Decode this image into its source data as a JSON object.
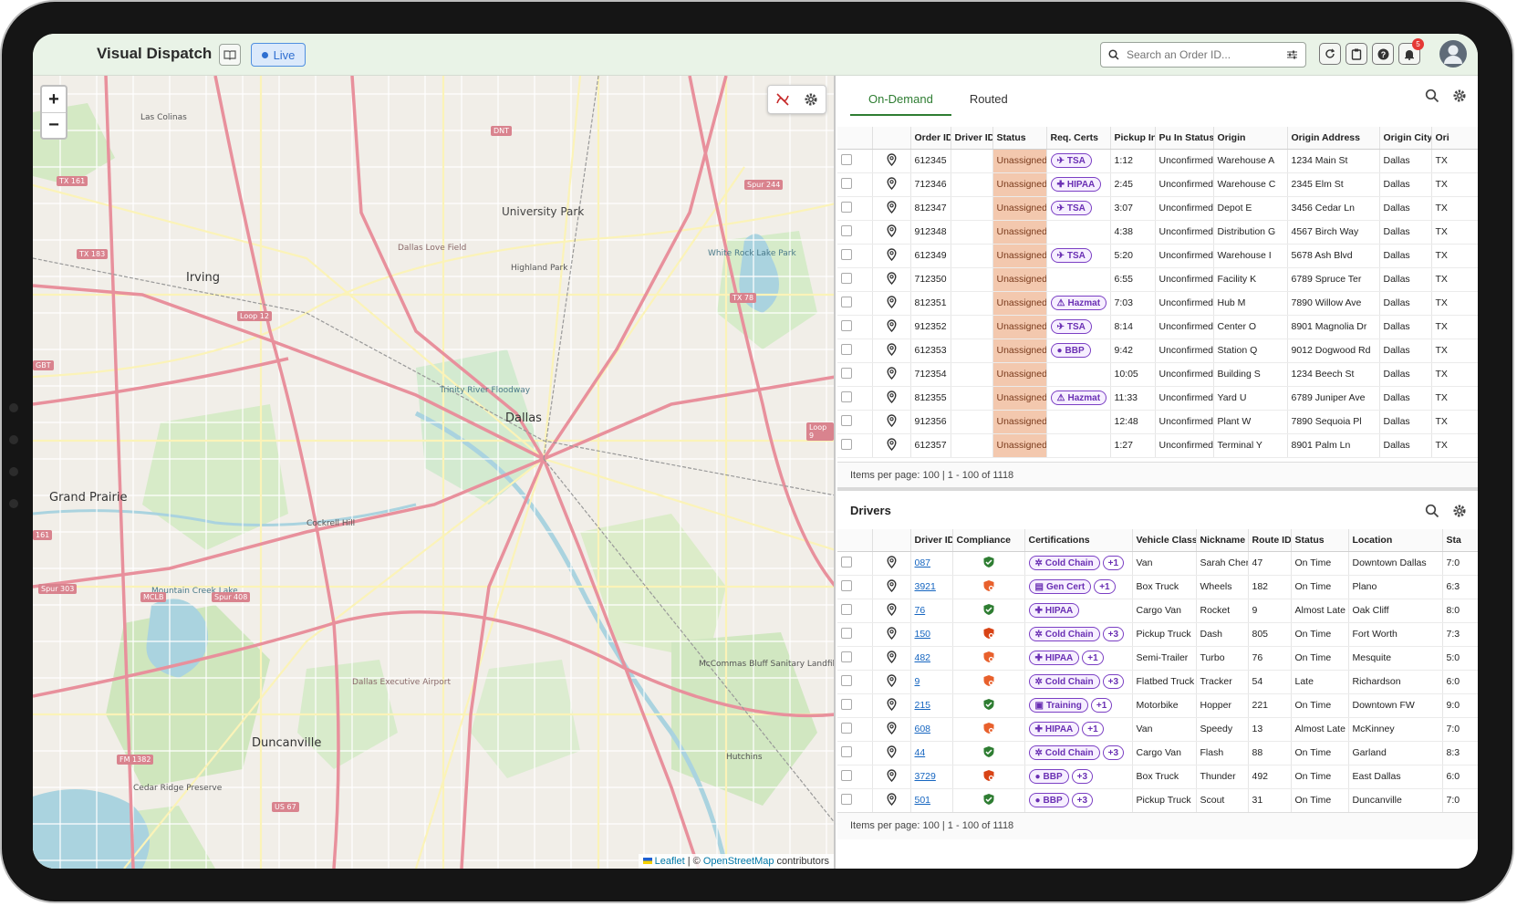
{
  "app": {
    "title": "Visual Dispatch",
    "live_label": "Live",
    "search_placeholder": "Search an Order ID...",
    "notification_count": "5"
  },
  "map": {
    "zoom_in": "+",
    "zoom_out": "−",
    "attribution": {
      "leaflet": "Leaflet",
      "sep": " | © ",
      "osm": "OpenStreetMap",
      "suffix": " contributors"
    },
    "labels": {
      "dallas": "Dallas",
      "irving": "Irving",
      "grand_prairie": "Grand Prairie",
      "duncanville": "Duncanville",
      "university_park": "University Park",
      "highland_park": "Highland Park",
      "las_colinas": "Las Colinas",
      "cockrell_hill": "Cockrell Hill",
      "dallas_love_field": "Dallas Love Field",
      "white_rock": "White Rock Lake Park",
      "trinity": "Trinity River Floodway",
      "mountain_creek": "Mountain Creek Lake",
      "dallas_executive": "Dallas Executive Airport",
      "mccommas": "McCommas Bluff Sanitary Landfill",
      "hutchins": "Hutchins",
      "cedar_ridge": "Cedar Ridge Preserve",
      "tx161": "TX 161",
      "tx183": "TX 183",
      "loop12": "Loop 12",
      "tx78": "TX 78",
      "spur244": "Spur 244",
      "dnt": "DNT",
      "spur303": "Spur 303",
      "mclb": "MCLB",
      "spur408": "Spur 408",
      "fm1382": "FM 1382",
      "us67": "US 67",
      "loop9": "Loop 9",
      "gbt": "GBT",
      "r161": "161"
    }
  },
  "orders": {
    "tabs": [
      "On-Demand",
      "Routed"
    ],
    "columns": [
      "Order ID",
      "Driver ID",
      "Status",
      "Req. Certs",
      "Pickup In",
      "Pu In Status",
      "Origin",
      "Origin Address",
      "Origin City",
      "Ori"
    ],
    "rows": [
      {
        "id": "612345",
        "driver": "",
        "status": "Unassigned",
        "cert": "TSA",
        "cert_icon": "✈",
        "pickup": "1:12",
        "pu_status": "Unconfirmed",
        "origin": "Warehouse A",
        "address": "1234 Main St",
        "city": "Dallas",
        "state": "TX"
      },
      {
        "id": "712346",
        "driver": "",
        "status": "Unassigned",
        "cert": "HIPAA",
        "cert_icon": "✚",
        "pickup": "2:45",
        "pu_status": "Unconfirmed",
        "origin": "Warehouse C",
        "address": "2345 Elm St",
        "city": "Dallas",
        "state": "TX"
      },
      {
        "id": "812347",
        "driver": "",
        "status": "Unassigned",
        "cert": "TSA",
        "cert_icon": "✈",
        "pickup": "3:07",
        "pu_status": "Unconfirmed",
        "origin": "Depot E",
        "address": "3456 Cedar Ln",
        "city": "Dallas",
        "state": "TX"
      },
      {
        "id": "912348",
        "driver": "",
        "status": "Unassigned",
        "cert": "",
        "cert_icon": "",
        "pickup": "4:38",
        "pu_status": "Unconfirmed",
        "origin": "Distribution G",
        "address": "4567 Birch Way",
        "city": "Dallas",
        "state": "TX"
      },
      {
        "id": "612349",
        "driver": "",
        "status": "Unassigned",
        "cert": "TSA",
        "cert_icon": "✈",
        "pickup": "5:20",
        "pu_status": "Unconfirmed",
        "origin": "Warehouse I",
        "address": "5678 Ash Blvd",
        "city": "Dallas",
        "state": "TX"
      },
      {
        "id": "712350",
        "driver": "",
        "status": "Unassigned",
        "cert": "",
        "cert_icon": "",
        "pickup": "6:55",
        "pu_status": "Unconfirmed",
        "origin": "Facility K",
        "address": "6789 Spruce Ter",
        "city": "Dallas",
        "state": "TX"
      },
      {
        "id": "812351",
        "driver": "",
        "status": "Unassigned",
        "cert": "Hazmat",
        "cert_icon": "⚠",
        "pickup": "7:03",
        "pu_status": "Unconfirmed",
        "origin": "Hub M",
        "address": "7890 Willow Ave",
        "city": "Dallas",
        "state": "TX"
      },
      {
        "id": "912352",
        "driver": "",
        "status": "Unassigned",
        "cert": "TSA",
        "cert_icon": "✈",
        "pickup": "8:14",
        "pu_status": "Unconfirmed",
        "origin": "Center O",
        "address": "8901 Magnolia Dr",
        "city": "Dallas",
        "state": "TX"
      },
      {
        "id": "612353",
        "driver": "",
        "status": "Unassigned",
        "cert": "BBP",
        "cert_icon": "●",
        "pickup": "9:42",
        "pu_status": "Unconfirmed",
        "origin": "Station Q",
        "address": "9012 Dogwood Rd",
        "city": "Dallas",
        "state": "TX"
      },
      {
        "id": "712354",
        "driver": "",
        "status": "Unassigned",
        "cert": "",
        "cert_icon": "",
        "pickup": "10:05",
        "pu_status": "Unconfirmed",
        "origin": "Building S",
        "address": "1234 Beech St",
        "city": "Dallas",
        "state": "TX"
      },
      {
        "id": "812355",
        "driver": "",
        "status": "Unassigned",
        "cert": "Hazmat",
        "cert_icon": "⚠",
        "pickup": "11:33",
        "pu_status": "Unconfirmed",
        "origin": "Yard U",
        "address": "6789 Juniper Ave",
        "city": "Dallas",
        "state": "TX"
      },
      {
        "id": "912356",
        "driver": "",
        "status": "Unassigned",
        "cert": "",
        "cert_icon": "",
        "pickup": "12:48",
        "pu_status": "Unconfirmed",
        "origin": "Plant W",
        "address": "7890 Sequoia Pl",
        "city": "Dallas",
        "state": "TX"
      },
      {
        "id": "612357",
        "driver": "",
        "status": "Unassigned",
        "cert": "",
        "cert_icon": "",
        "pickup": "1:27",
        "pu_status": "Unconfirmed",
        "origin": "Terminal Y",
        "address": "8901 Palm Ln",
        "city": "Dallas",
        "state": "TX"
      }
    ],
    "footer": "Items per page: 100 | 1 - 100 of 1118"
  },
  "drivers": {
    "title": "Drivers",
    "columns": [
      "Driver ID",
      "Compliance",
      "Certifications",
      "Vehicle Class",
      "Nickname",
      "Route ID",
      "Status",
      "Location",
      "Sta"
    ],
    "rows": [
      {
        "id": "087",
        "compliance": "ok",
        "cert": "Cold Chain",
        "cert_icon": "✲",
        "more": "+1",
        "vehicle": "Van",
        "nickname": "Sarah Chen",
        "route": "47",
        "status": "On Time",
        "location": "Downtown Dallas",
        "start": "7:0"
      },
      {
        "id": "3921",
        "compliance": "warn",
        "cert": "Gen Cert",
        "cert_icon": "▤",
        "more": "+1",
        "vehicle": "Box Truck",
        "nickname": "Wheels",
        "route": "182",
        "status": "On Time",
        "location": "Plano",
        "start": "6:3"
      },
      {
        "id": "76",
        "compliance": "ok",
        "cert": "HIPAA",
        "cert_icon": "✚",
        "more": "",
        "vehicle": "Cargo Van",
        "nickname": "Rocket",
        "route": "9",
        "status": "Almost Late",
        "location": "Oak Cliff",
        "start": "8:0"
      },
      {
        "id": "150",
        "compliance": "bad",
        "cert": "Cold Chain",
        "cert_icon": "✲",
        "more": "+3",
        "vehicle": "Pickup Truck",
        "nickname": "Dash",
        "route": "805",
        "status": "On Time",
        "location": "Fort Worth",
        "start": "7:3"
      },
      {
        "id": "482",
        "compliance": "warn",
        "cert": "HIPAA",
        "cert_icon": "✚",
        "more": "+1",
        "vehicle": "Semi-Trailer",
        "nickname": "Turbo",
        "route": "76",
        "status": "On Time",
        "location": "Mesquite",
        "start": "5:0"
      },
      {
        "id": "9",
        "compliance": "warn",
        "cert": "Cold Chain",
        "cert_icon": "✲",
        "more": "+3",
        "vehicle": "Flatbed Truck",
        "nickname": "Tracker",
        "route": "54",
        "status": "Late",
        "location": "Richardson",
        "start": "6:0"
      },
      {
        "id": "215",
        "compliance": "ok",
        "cert": "Training",
        "cert_icon": "▣",
        "more": "+1",
        "vehicle": "Motorbike",
        "nickname": "Hopper",
        "route": "221",
        "status": "On Time",
        "location": "Downtown FW",
        "start": "9:0"
      },
      {
        "id": "608",
        "compliance": "warn",
        "cert": "HIPAA",
        "cert_icon": "✚",
        "more": "+1",
        "vehicle": "Van",
        "nickname": "Speedy",
        "route": "13",
        "status": "Almost Late",
        "location": "McKinney",
        "start": "7:0"
      },
      {
        "id": "44",
        "compliance": "ok",
        "cert": "Cold Chain",
        "cert_icon": "✲",
        "more": "+3",
        "vehicle": "Cargo Van",
        "nickname": "Flash",
        "route": "88",
        "status": "On Time",
        "location": "Garland",
        "start": "8:3"
      },
      {
        "id": "3729",
        "compliance": "bad",
        "cert": "BBP",
        "cert_icon": "●",
        "more": "+3",
        "vehicle": "Box Truck",
        "nickname": "Thunder",
        "route": "492",
        "status": "On Time",
        "location": "East Dallas",
        "start": "6:0"
      },
      {
        "id": "501",
        "compliance": "ok",
        "cert": "BBP",
        "cert_icon": "●",
        "more": "+3",
        "vehicle": "Pickup Truck",
        "nickname": "Scout",
        "route": "31",
        "status": "On Time",
        "location": "Duncanville",
        "start": "7:0"
      }
    ],
    "footer": "Items per page: 100 | 1 - 100 of 1118"
  },
  "colors": {
    "accent_green": "#2e7d32",
    "unassigned_bg": "#f3c8ae",
    "cert_purple": "#7b3fc4",
    "live_blue": "#2f6fd0",
    "ok_green": "#2e7d32",
    "warn_orange": "#e8602c",
    "bad_red": "#d84315"
  }
}
